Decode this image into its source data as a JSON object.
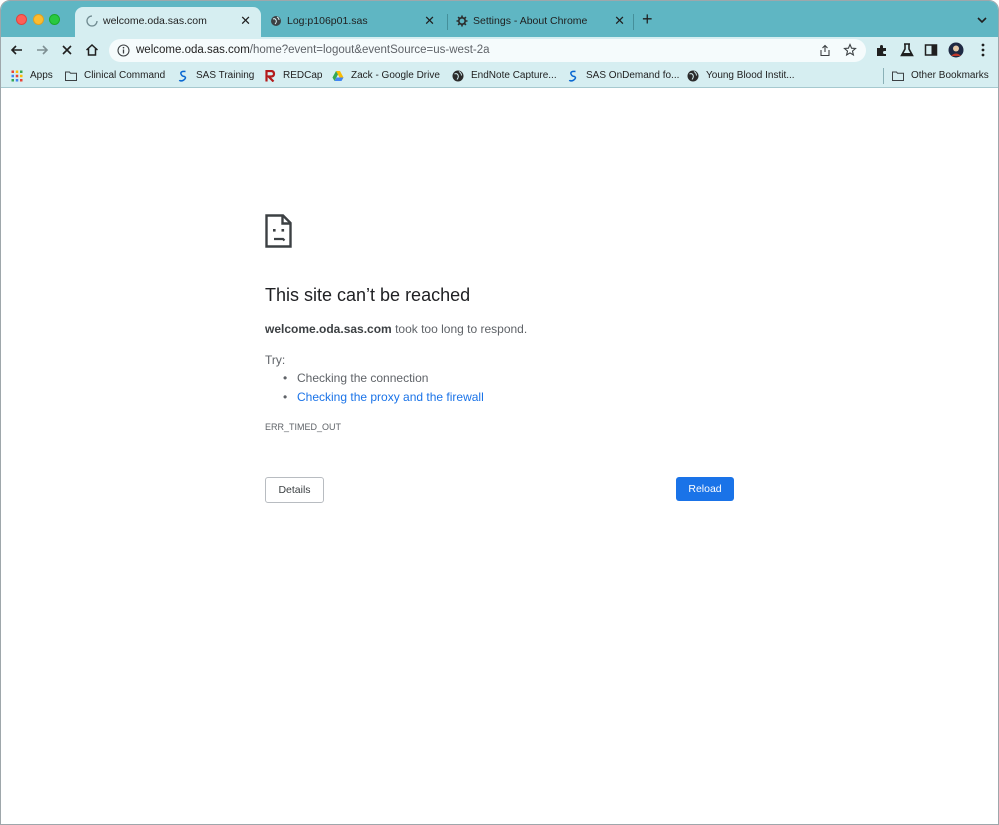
{
  "tabs": [
    {
      "title": "welcome.oda.sas.com",
      "icon": "loading-spinner-icon",
      "active": true
    },
    {
      "title": "Log:p106p01.sas",
      "icon": "globe-icon",
      "active": false
    },
    {
      "title": "Settings - About Chrome",
      "icon": "gear-icon",
      "active": false
    }
  ],
  "tab_close_glyph": "✕",
  "new_tab_glyph": "+",
  "address_bar": {
    "host": "welcome.oda.sas.com",
    "path": "/home?event=logout&eventSource=us-west-2a"
  },
  "bookmarks": [
    {
      "label": "Apps",
      "icon": "apps-grid-icon"
    },
    {
      "label": "Clinical Command",
      "icon": "folder-icon"
    },
    {
      "label": "SAS Training",
      "icon": "sas-logo-icon"
    },
    {
      "label": "REDCap",
      "icon": "redcap-icon"
    },
    {
      "label": "Zack - Google Drive",
      "icon": "google-drive-icon"
    },
    {
      "label": "EndNote Capture...",
      "icon": "globe-icon"
    },
    {
      "label": "SAS OnDemand fo...",
      "icon": "sas-logo-icon"
    },
    {
      "label": "Young Blood Instit...",
      "icon": "globe-icon"
    }
  ],
  "other_bookmarks": {
    "label": "Other Bookmarks",
    "icon": "folder-icon"
  },
  "error": {
    "title": "This site can’t be reached",
    "host": "welcome.oda.sas.com",
    "message": "took too long to respond.",
    "try_label": "Try:",
    "suggestions": [
      "Checking the connection",
      "Checking the proxy and the firewall"
    ],
    "code": "ERR_TIMED_OUT",
    "details_button": "Details",
    "reload_button": "Reload"
  },
  "colors": {
    "tab_strip": "#5fb6c3",
    "toolbar": "#d6eef1",
    "link": "#1a73e8",
    "reload_button": "#1a73e8"
  }
}
